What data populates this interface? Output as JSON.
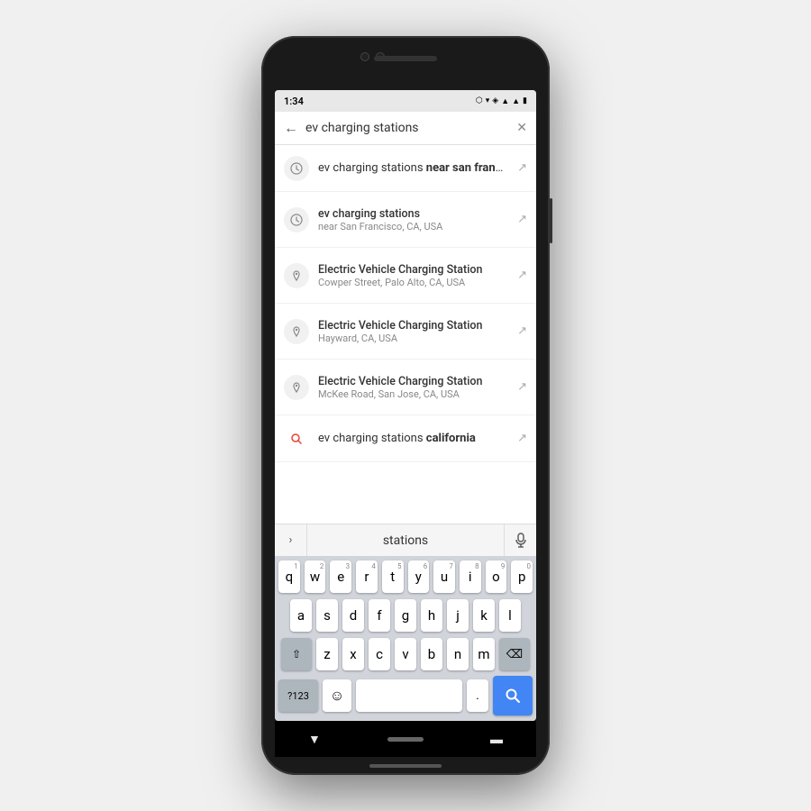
{
  "statusBar": {
    "time": "1:34",
    "icons": [
      "nav",
      "wifi",
      "location",
      "signal",
      "signal2",
      "battery"
    ]
  },
  "searchBar": {
    "backArrow": "←",
    "query": "ev charging stations",
    "clearBtn": "✕"
  },
  "suggestions": [
    {
      "id": 1,
      "iconType": "clock",
      "mainText": "ev charging stations",
      "mainBold": "near san franc...",
      "subText": "",
      "twoLine": false
    },
    {
      "id": 2,
      "iconType": "clock",
      "mainText": "ev charging stations",
      "mainBold": "",
      "subText": "near San Francisco, CA, USA",
      "twoLine": true
    },
    {
      "id": 3,
      "iconType": "pin",
      "mainText": "Electric Vehicle Charging Station",
      "mainBold": "",
      "subText": "Cowper Street, Palo Alto, CA, USA",
      "twoLine": true
    },
    {
      "id": 4,
      "iconType": "pin",
      "mainText": "Electric Vehicle Charging Station",
      "mainBold": "",
      "subText": "Hayward, CA, USA",
      "twoLine": true
    },
    {
      "id": 5,
      "iconType": "pin",
      "mainText": "Electric Vehicle Charging Station",
      "mainBold": "",
      "subText": "McKee Road, San Jose, CA, USA",
      "twoLine": true
    },
    {
      "id": 6,
      "iconType": "search-red",
      "mainText": "ev charging stations ",
      "mainBold": "california",
      "subText": "",
      "twoLine": false
    }
  ],
  "keyboardSuggest": {
    "expandIcon": "›",
    "word": "stations",
    "micIcon": "🎤"
  },
  "keyboard": {
    "row1": [
      {
        "key": "q",
        "num": "1"
      },
      {
        "key": "w",
        "num": "2"
      },
      {
        "key": "e",
        "num": "3"
      },
      {
        "key": "r",
        "num": "4"
      },
      {
        "key": "t",
        "num": "5"
      },
      {
        "key": "y",
        "num": "6"
      },
      {
        "key": "u",
        "num": "7"
      },
      {
        "key": "i",
        "num": "8"
      },
      {
        "key": "o",
        "num": "9"
      },
      {
        "key": "p",
        "num": "0"
      }
    ],
    "row2": [
      {
        "key": "a"
      },
      {
        "key": "s"
      },
      {
        "key": "d"
      },
      {
        "key": "f"
      },
      {
        "key": "g"
      },
      {
        "key": "h"
      },
      {
        "key": "j"
      },
      {
        "key": "k"
      },
      {
        "key": "l"
      }
    ],
    "row3": [
      {
        "key": "⇧",
        "special": true
      },
      {
        "key": "z"
      },
      {
        "key": "x"
      },
      {
        "key": "c"
      },
      {
        "key": "v"
      },
      {
        "key": "b"
      },
      {
        "key": "n"
      },
      {
        "key": "m"
      },
      {
        "key": "⌫",
        "special": true
      }
    ],
    "bottomRow": {
      "sym": "?123",
      "emoji": "☺",
      "spacePlaceholder": "",
      "period": ".",
      "searchIcon": "🔍"
    }
  },
  "bottomNav": {
    "backBtn": "▼",
    "homeBar": "",
    "menuBtn": "▬"
  }
}
